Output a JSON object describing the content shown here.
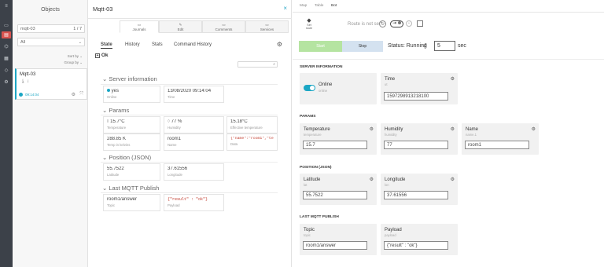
{
  "rail": {
    "icons": [
      "folder-icon",
      "database-icon",
      "tree-icon",
      "calendar-icon",
      "tag-icon",
      "settings-icon"
    ]
  },
  "objects": {
    "title": "Objects",
    "search_value": "mqtt-03",
    "count": "1 / 7",
    "filter_value": "All",
    "sort_label": "Sort by",
    "group_label": "Group by",
    "card": {
      "name": "Mqtt-03",
      "time": "09:14:04"
    }
  },
  "detail": {
    "title": "Mqtt-03",
    "top_tabs": [
      "Journals",
      "Edit",
      "Comments",
      "Services"
    ],
    "sub_tabs": [
      "State",
      "History",
      "Stats",
      "Command History"
    ],
    "ok_label": "Ok",
    "server": {
      "title": "Server information",
      "online_value": "yes",
      "online_label": "Online",
      "time_value": "13/08/2020 09:14:04",
      "time_label": "Time"
    },
    "params": {
      "title": "Params",
      "temperature_value": "15.7°C",
      "temperature_label": "Temperature",
      "humidity_value": "77 %",
      "humidity_label": "Humidity",
      "effective_value": "15.18°C",
      "effective_label": "Effective temperature",
      "kelvin_value": "288.85 K",
      "kelvin_label": "Temp in kelvins",
      "name_value": "room1",
      "name_label": "Name",
      "data_value": "{\"name\":\"room1\",\"temp",
      "data_label": "Data"
    },
    "position": {
      "title": "Position (JSON)",
      "lat_value": "55.7522",
      "lat_label": "Latitude",
      "lon_value": "37.61556",
      "lon_label": "Longitude"
    },
    "mqtt": {
      "title": "Last MQTT Publish",
      "topic_value": "room1/answer",
      "topic_label": "Topic",
      "payload_value": "{\"result\" : \"ok\"}",
      "payload_label": "Payload"
    }
  },
  "right": {
    "tabs": [
      "Map",
      "Table",
      "Bot"
    ],
    "set_route_label": "Set route",
    "route_status": "Route is not set",
    "start_label": "Start",
    "stop_label": "Stop",
    "status_text": "Status: Running",
    "interval_value": "5",
    "interval_unit": "sec",
    "server_title": "SERVER INFORMATION",
    "online_title": "Online",
    "online_sub": "online",
    "time_title": "Time",
    "time_sub": "ut",
    "time_value": "1597298913218100",
    "params_title": "PARAMS",
    "temperature_title": "Temperature",
    "temperature_sub": "temperature",
    "temperature_value": "15.7",
    "humidity_title": "Humidity",
    "humidity_sub": "humidity",
    "humidity_value": "77",
    "name_title": "Name",
    "name_sub": "name.1",
    "name_value": "room1",
    "position_title": "POSITION (JSON)",
    "lat_title": "Latitude",
    "lat_sub": "lat",
    "lat_value": "55.7522",
    "lon_title": "Longitude",
    "lon_sub": "lon",
    "lon_value": "37.61556",
    "mqtt_title": "LAST MQTT PUBLISH",
    "topic_title": "Topic",
    "topic_sub": "topic",
    "topic_value": "room1/answer",
    "payload_title": "Payload",
    "payload_sub": "payload",
    "payload_value": "{\"result\" : \"ok\"}"
  },
  "colors": {
    "accent": "#1ba6c4",
    "rail": "#3c4149",
    "rail_active": "#d9534f",
    "start_green": "#b5e4a1"
  }
}
